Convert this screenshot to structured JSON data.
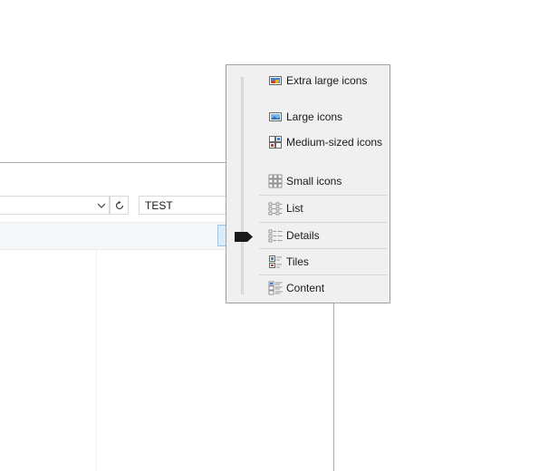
{
  "explorer": {
    "search": {
      "value": "TEST"
    }
  },
  "view_menu": {
    "selected": "Details",
    "items": [
      {
        "label": "Extra large icons",
        "icon": "extra-large-icons-icon"
      },
      {
        "label": "Large icons",
        "icon": "large-icons-icon"
      },
      {
        "label": "Medium-sized icons",
        "icon": "medium-icons-icon"
      },
      {
        "label": "Small icons",
        "icon": "small-icons-icon"
      },
      {
        "label": "List",
        "icon": "list-icon"
      },
      {
        "label": "Details",
        "icon": "details-icon"
      },
      {
        "label": "Tiles",
        "icon": "tiles-icon"
      },
      {
        "label": "Content",
        "icon": "content-icon"
      }
    ]
  },
  "colors": {
    "slider_thumb": "#1a1a1a",
    "popup_background": "#f0f0f0",
    "popup_border": "#a0a0a0"
  }
}
